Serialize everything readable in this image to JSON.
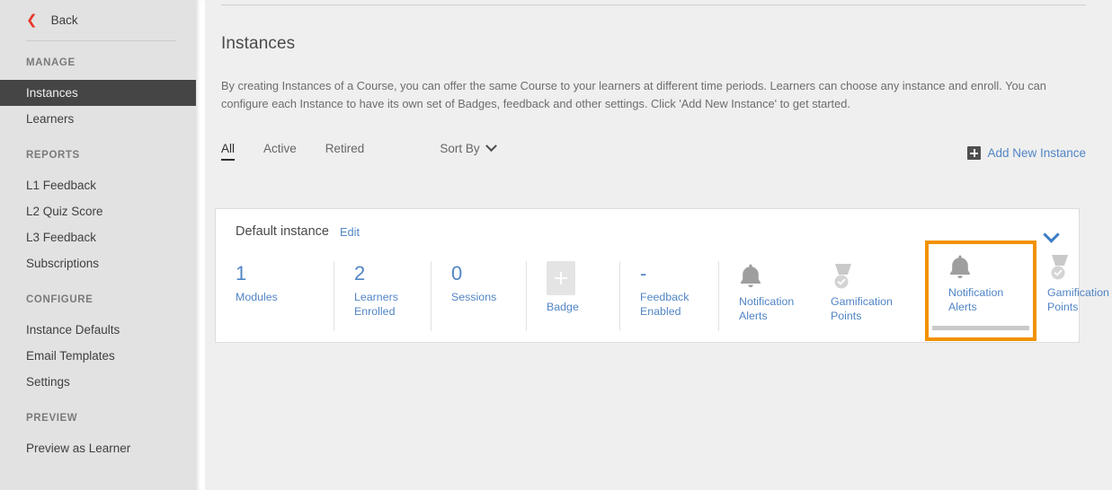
{
  "sidebar": {
    "back": {
      "label": "Back",
      "icon": "chevron-left-icon"
    },
    "groups": [
      {
        "title": "MANAGE",
        "items": [
          {
            "label": "Instances",
            "active": true
          },
          {
            "label": "Learners",
            "active": false
          }
        ]
      },
      {
        "title": "REPORTS",
        "items": [
          {
            "label": "L1 Feedback",
            "active": false
          },
          {
            "label": "L2 Quiz Score",
            "active": false
          },
          {
            "label": "L3 Feedback",
            "active": false
          },
          {
            "label": "Subscriptions",
            "active": false
          }
        ]
      },
      {
        "title": "CONFIGURE",
        "items": [
          {
            "label": "Instance Defaults",
            "active": false
          },
          {
            "label": "Email Templates",
            "active": false
          },
          {
            "label": "Settings",
            "active": false
          }
        ]
      },
      {
        "title": "PREVIEW",
        "items": [
          {
            "label": "Preview as Learner",
            "active": false
          }
        ]
      }
    ]
  },
  "main": {
    "title": "Instances",
    "description": "By creating Instances of a Course, you can offer the same Course to your learners at different time periods. Learners can choose any instance and enroll. You can configure each Instance to have its own set of Badges, feedback and other settings. Click 'Add New Instance' to get started.",
    "tabs": [
      {
        "label": "All",
        "active": true
      },
      {
        "label": "Active",
        "active": false
      },
      {
        "label": "Retired",
        "active": false
      }
    ],
    "sort_by": {
      "label": "Sort By",
      "icon": "chevron-down-icon"
    },
    "add_new_instance": {
      "label": "Add New Instance",
      "icon": "plus-square-icon"
    }
  },
  "instance_card": {
    "title": "Default instance",
    "edit_label": "Edit",
    "collapse_icon": "chevron-down-icon",
    "stats": [
      {
        "value": "1",
        "label": "Modules",
        "icon": null
      },
      {
        "value": "2",
        "label": "Learners Enrolled",
        "icon": null
      },
      {
        "value": "0",
        "label": "Sessions",
        "icon": null
      },
      {
        "value": "",
        "label": "Badge",
        "icon": "add-badge-placeholder-icon"
      },
      {
        "value": "-",
        "label": "Feedback Enabled",
        "icon": null
      },
      {
        "value": "",
        "label": "Notification Alerts",
        "icon": "bell-icon"
      },
      {
        "value": "",
        "label": "Gamification Points",
        "icon": "medal-icon"
      }
    ]
  },
  "colors": {
    "accent_blue": "#5185c5",
    "highlight_orange": "#f29100",
    "back_arrow_red": "#e8372b",
    "sidebar_active_bg": "#454545",
    "sidebar_bg": "#e2e2e2",
    "page_bg": "#efefef"
  }
}
